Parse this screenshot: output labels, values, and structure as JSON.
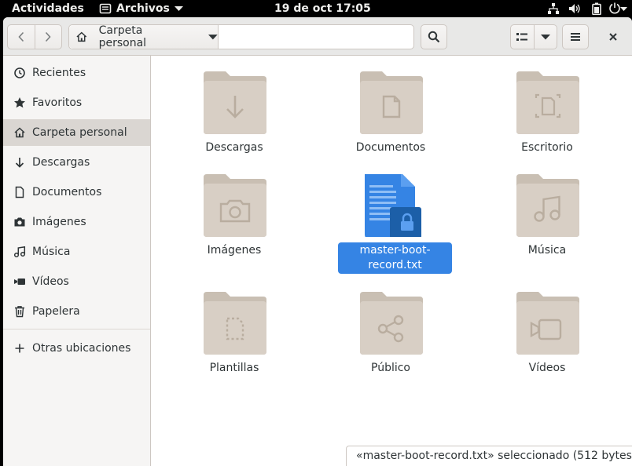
{
  "topbar": {
    "activities": "Actividades",
    "app_menu": "Archivos",
    "clock": "19 de oct  17:05",
    "tray_icons": [
      "network-icon",
      "volume-icon",
      "battery-icon",
      "power-menu-icon"
    ]
  },
  "window": {
    "path_label": "Carpeta personal"
  },
  "sidebar": {
    "items": [
      {
        "label": "Recientes",
        "icon": "clock-icon"
      },
      {
        "label": "Favoritos",
        "icon": "star-icon"
      },
      {
        "label": "Carpeta personal",
        "icon": "home-icon",
        "active": true
      },
      {
        "label": "Descargas",
        "icon": "download-icon"
      },
      {
        "label": "Documentos",
        "icon": "document-icon"
      },
      {
        "label": "Imágenes",
        "icon": "camera-icon"
      },
      {
        "label": "Música",
        "icon": "music-icon"
      },
      {
        "label": "Vídeos",
        "icon": "video-icon"
      },
      {
        "label": "Papelera",
        "icon": "trash-icon"
      }
    ],
    "other_locations": "Otras ubicaciones"
  },
  "files": [
    {
      "name": "Descargas",
      "icon": "download-folder-icon"
    },
    {
      "name": "Documentos",
      "icon": "document-folder-icon"
    },
    {
      "name": "Escritorio",
      "icon": "desktop-folder-icon"
    },
    {
      "name": "Imágenes",
      "icon": "pictures-folder-icon"
    },
    {
      "name": "master-boot-record.txt",
      "icon": "locked-text-file-icon",
      "selected": true
    },
    {
      "name": "Música",
      "icon": "music-folder-icon"
    },
    {
      "name": "Plantillas",
      "icon": "templates-folder-icon"
    },
    {
      "name": "Público",
      "icon": "public-share-folder-icon"
    },
    {
      "name": "Vídeos",
      "icon": "videos-folder-icon"
    }
  ],
  "status": "«master-boot-record.txt» seleccionado (512 bytes)",
  "colors": {
    "selection": "#3584e4",
    "folder": "#d8cfc5",
    "folder_tab": "#c9bfb3",
    "sidebar_bg": "#f6f5f4",
    "headerbar_bg": "#e8e8e7"
  }
}
